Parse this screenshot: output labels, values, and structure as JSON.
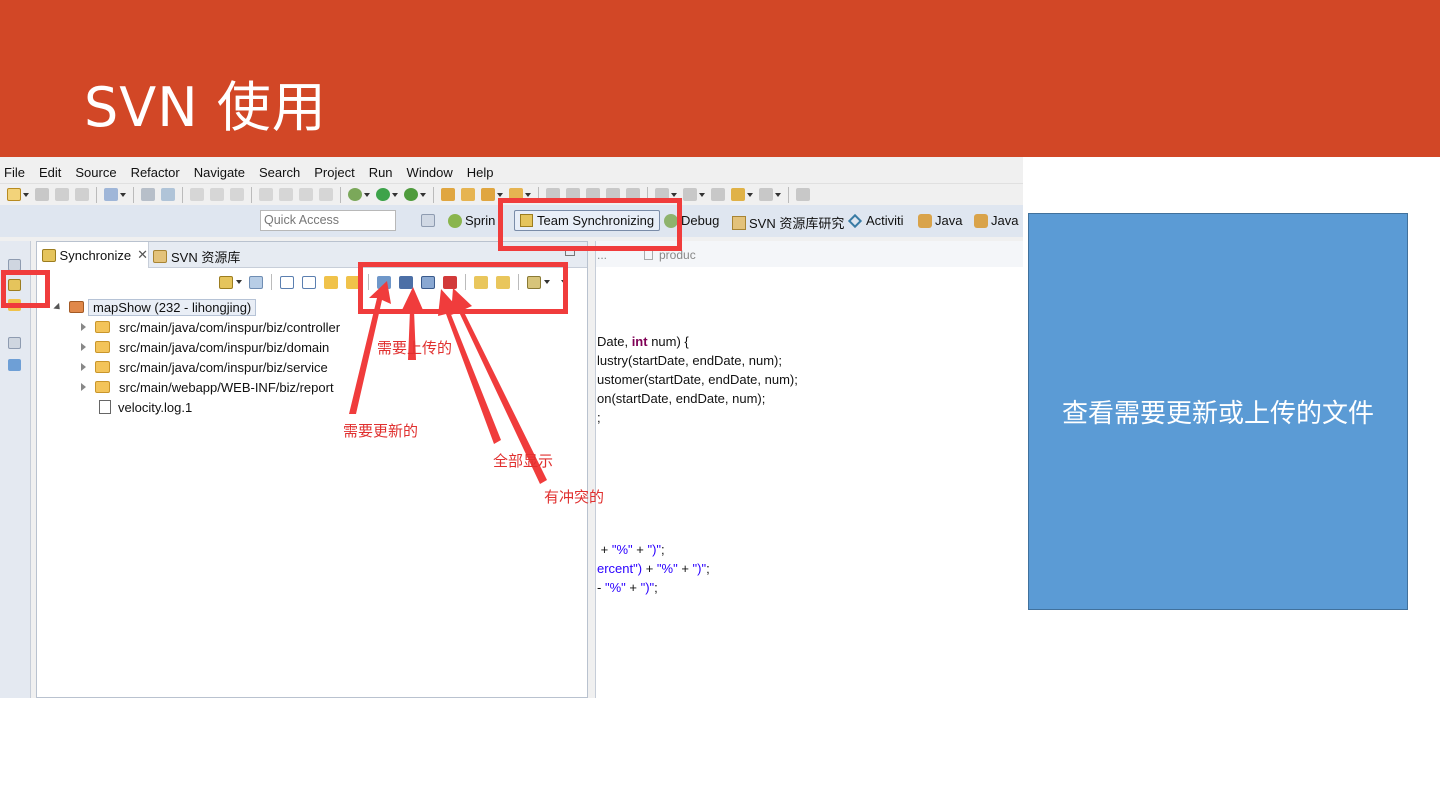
{
  "slide": {
    "title": "SVN 使用"
  },
  "menu": [
    "File",
    "Edit",
    "Source",
    "Refactor",
    "Navigate",
    "Search",
    "Project",
    "Run",
    "Window",
    "Help"
  ],
  "quick_access": {
    "placeholder": "Quick Access"
  },
  "perspectives": {
    "spring": "Sprin",
    "team": "Team Synchronizing",
    "debug": "Debug",
    "svn": "SVN 资源库研究",
    "activiti": "Activiti",
    "java": "Java",
    "java2": "Java"
  },
  "sync_view": {
    "tab_active": "Synchronize",
    "tab_inactive": "SVN 资源库",
    "project": "mapShow (232 - lihongjing)",
    "items": [
      "src/main/java/com/inspur/biz/controller",
      "src/main/java/com/inspur/biz/domain",
      "src/main/java/com/inspur/biz/service",
      "src/main/webapp/WEB-INF/biz/report",
      "velocity.log.1"
    ]
  },
  "editor": {
    "tab_partial": "...",
    "tab2": "produc",
    "lines": {
      "l1a": "Date, ",
      "l1kw": "int",
      "l1b": " num) {",
      "l2": "lustry(startDate, endDate, num);",
      "l3": "ustomer(startDate, endDate, num);",
      "l4": "on(startDate, endDate, num);",
      "l5": ";",
      "l6a": " + ",
      "l6s1": "\"%\"",
      "l6b": " + ",
      "l6s2": "\")\"",
      "l6c": ";",
      "l7s1": "ercent\")",
      "l7b": " + ",
      "l7s2": "\"%\"",
      "l7c": " + ",
      "l7s3": "\")\"",
      "l7d": ";",
      "l8a": "- ",
      "l8s1": "\"%\"",
      "l8b": " + ",
      "l8s2": "\")\"",
      "l8c": ";"
    }
  },
  "annotations": {
    "upload": "需要上传的",
    "update": "需要更新的",
    "show_all": "全部显示",
    "conflict": "有冲突的"
  },
  "callout": {
    "text": "查看需要更新或上传的文件"
  },
  "colors": {
    "banner": "#d24726",
    "callout": "#5b9bd5",
    "highlight": "#f03c3c"
  }
}
